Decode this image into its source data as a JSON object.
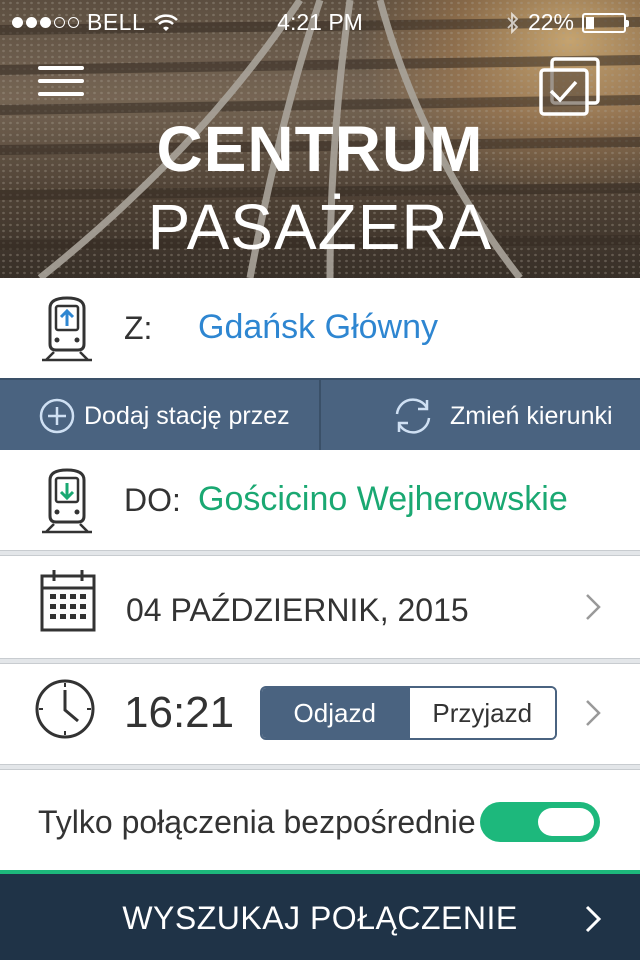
{
  "status_bar": {
    "carrier": "BELL",
    "time": "4:21 PM",
    "battery": "22%",
    "battery_level": 0.22,
    "signal_bars_filled": 3,
    "signal_bars_total": 5
  },
  "header": {
    "title_line1": "CENTRUM",
    "title_line2": "PASAŻERA",
    "menu_icon": "hamburger-menu-icon",
    "tickets_icon": "tickets-check-icon"
  },
  "from": {
    "label": "Z:",
    "station": "Gdańsk Główny",
    "icon": "train-departure-icon"
  },
  "actions": {
    "add_via": "Dodaj stację przez",
    "swap": "Zmień kierunki"
  },
  "to": {
    "label": "DO:",
    "station": "Gościcino Wejherowskie",
    "icon": "train-arrival-icon"
  },
  "date": {
    "value": "04 PAŹDZIERNIK, 2015",
    "icon": "calendar-icon"
  },
  "time": {
    "value": "16:21",
    "icon": "clock-icon",
    "segments": [
      "Odjazd",
      "Przyjazd"
    ],
    "selected": "Odjazd"
  },
  "direct_only": {
    "label": "Tylko połączenia bezpośrednie",
    "enabled": true
  },
  "search_button": {
    "label": "WYSZUKAJ POŁĄCZENIE"
  },
  "colors": {
    "from_station": "#2e86d1",
    "to_station": "#1aa872",
    "action_bar": "#4a6380",
    "search_bar": "#1f3347",
    "toggle_on": "#1db87c"
  }
}
